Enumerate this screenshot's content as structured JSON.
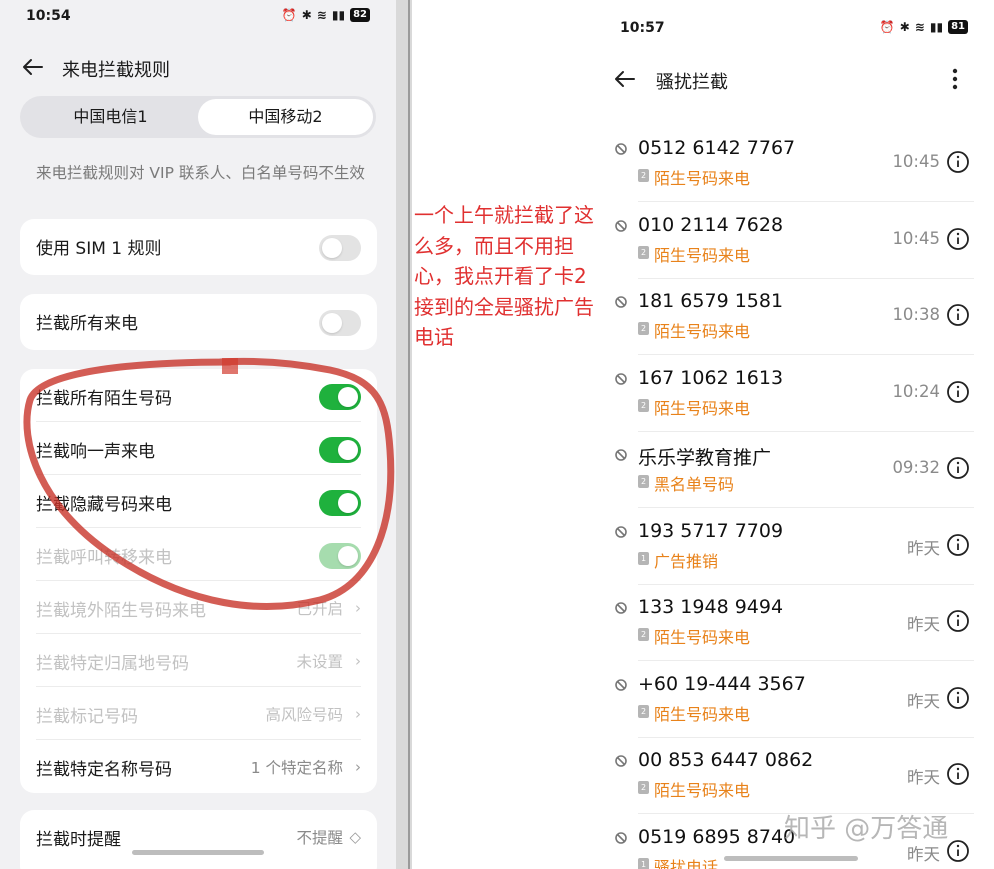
{
  "left_screen": {
    "status_time": "10:54",
    "battery": "82",
    "title": "来电拦截规则",
    "sim_tabs": [
      {
        "label": "中国电信1",
        "selected": false
      },
      {
        "label": "中国移动2",
        "selected": true
      }
    ],
    "hint": "来电拦截规则对 VIP 联系人、白名单号码不生效",
    "use_sim1_rule": "使用 SIM 1 规则",
    "block_all": "拦截所有来电",
    "rules": [
      {
        "label": "拦截所有陌生号码",
        "enabled": true
      },
      {
        "label": "拦截响一声来电",
        "enabled": true
      },
      {
        "label": "拦截隐藏号码来电",
        "enabled": true
      },
      {
        "label": "拦截呼叫转移来电",
        "enabled": true
      },
      {
        "label": "拦截境外陌生号码来电",
        "value": "已开启"
      },
      {
        "label": "拦截特定归属地号码",
        "value": "未设置"
      },
      {
        "label": "拦截标记号码",
        "value": "高风险号码"
      },
      {
        "label": "拦截特定名称号码",
        "value": "1 个特定名称"
      }
    ],
    "reminder": {
      "label": "拦截时提醒",
      "value": "不提醒"
    }
  },
  "annotation": "一个上午就拦截了这么多，而且不用担心，我点开看了卡2接到的全是骚扰广告电话",
  "right_screen": {
    "status_time": "10:57",
    "battery": "81",
    "title": "骚扰拦截",
    "calls": [
      {
        "number": "0512 6142 7767",
        "sim": "2",
        "tag": "陌生号码来电",
        "time": "10:45"
      },
      {
        "number": "010 2114 7628",
        "sim": "2",
        "tag": "陌生号码来电",
        "time": "10:45"
      },
      {
        "number": "181 6579 1581",
        "sim": "2",
        "tag": "陌生号码来电",
        "time": "10:38"
      },
      {
        "number": "167 1062 1613",
        "sim": "2",
        "tag": "陌生号码来电",
        "time": "10:24"
      },
      {
        "number": "乐乐学教育推广",
        "sim": "2",
        "tag": "黑名单号码",
        "time": "09:32"
      },
      {
        "number": "193 5717 7709",
        "sim": "1",
        "tag": "广告推销",
        "time": "昨天"
      },
      {
        "number": "133 1948 9494",
        "sim": "2",
        "tag": "陌生号码来电",
        "time": "昨天"
      },
      {
        "number": "+60 19-444 3567",
        "sim": "2",
        "tag": "陌生号码来电",
        "time": "昨天"
      },
      {
        "number": "00 853 6447 0862",
        "sim": "2",
        "tag": "陌生号码来电",
        "time": "昨天"
      },
      {
        "number": "0519 6895 8740",
        "sim": "1",
        "tag": "骚扰电话",
        "time": "昨天"
      }
    ]
  },
  "watermark": "知乎 @万答通",
  "colors": {
    "toggle_on": "#1fb13d",
    "tag_orange": "#e8821a",
    "annotation_red": "#e03030"
  },
  "icons": [
    "back-arrow-icon",
    "alarm-icon",
    "bluetooth-icon",
    "wifi-icon",
    "signal-icon",
    "battery-icon",
    "more-vert-icon",
    "block-icon",
    "info-icon",
    "chevron-right-icon",
    "sim-icon"
  ]
}
